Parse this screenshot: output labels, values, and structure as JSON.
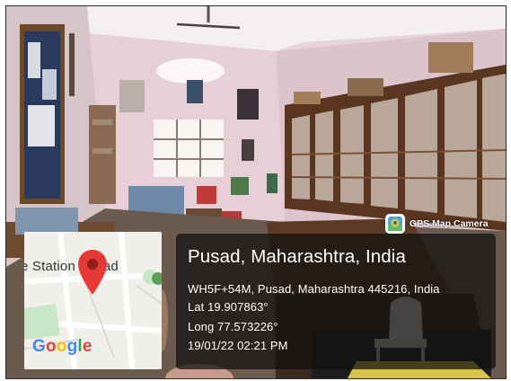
{
  "watermark": {
    "app_name": "GPS Map Camera",
    "icon": "gps-map-camera-icon"
  },
  "map": {
    "place_label": "e Station Pusad",
    "google_logo": "Google",
    "icon": "location-pin-icon"
  },
  "location": {
    "title": "Pusad, Maharashtra, India",
    "address": "WH5F+54M, Pusad, Maharashtra 445216, India",
    "latitude": "Lat 19.907863°",
    "longitude": "Long 77.573226°",
    "datetime": "19/01/22 02:21 PM"
  },
  "colors": {
    "google_blue": "#4285F4",
    "google_red": "#EA4335",
    "google_yellow": "#FBBC05",
    "google_green": "#34A853",
    "pin_red": "#E53935"
  }
}
